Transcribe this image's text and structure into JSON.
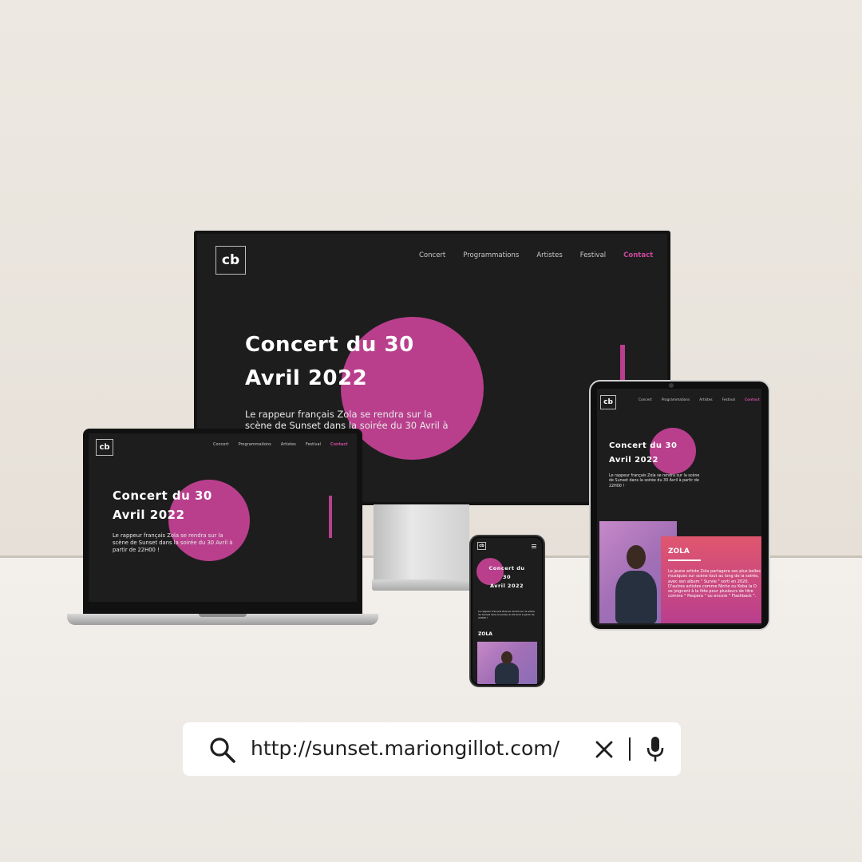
{
  "site": {
    "logo_text": "cb",
    "nav": [
      "Concert",
      "Programmations",
      "Artistes",
      "Festival",
      "Contact"
    ],
    "hero_title_line1": "Concert du 30",
    "hero_title_line2": "Avril 2022",
    "hero_text": "Le rappeur français Zola se rendra sur la scène de Sunset dans la soirée du 30 Avril à partir de 22H00 !",
    "artist_name": "ZOLA",
    "artist_text": "Le jeune artiste Zola partagera ses plus belles musiques sur scène tout au long de la soirée, avec son album \" Survie \" sorti en 2020. D'autres artistes comme Ninho ou Koba la D se joignent à la fête pour plusieurs de titre comme \" Pespera \" ou encore \" Flashback \"."
  },
  "search": {
    "url": "http://sunset.mariongillot.com/"
  },
  "colors": {
    "accent": "#b93f8d",
    "background": "#1e1d1e"
  }
}
